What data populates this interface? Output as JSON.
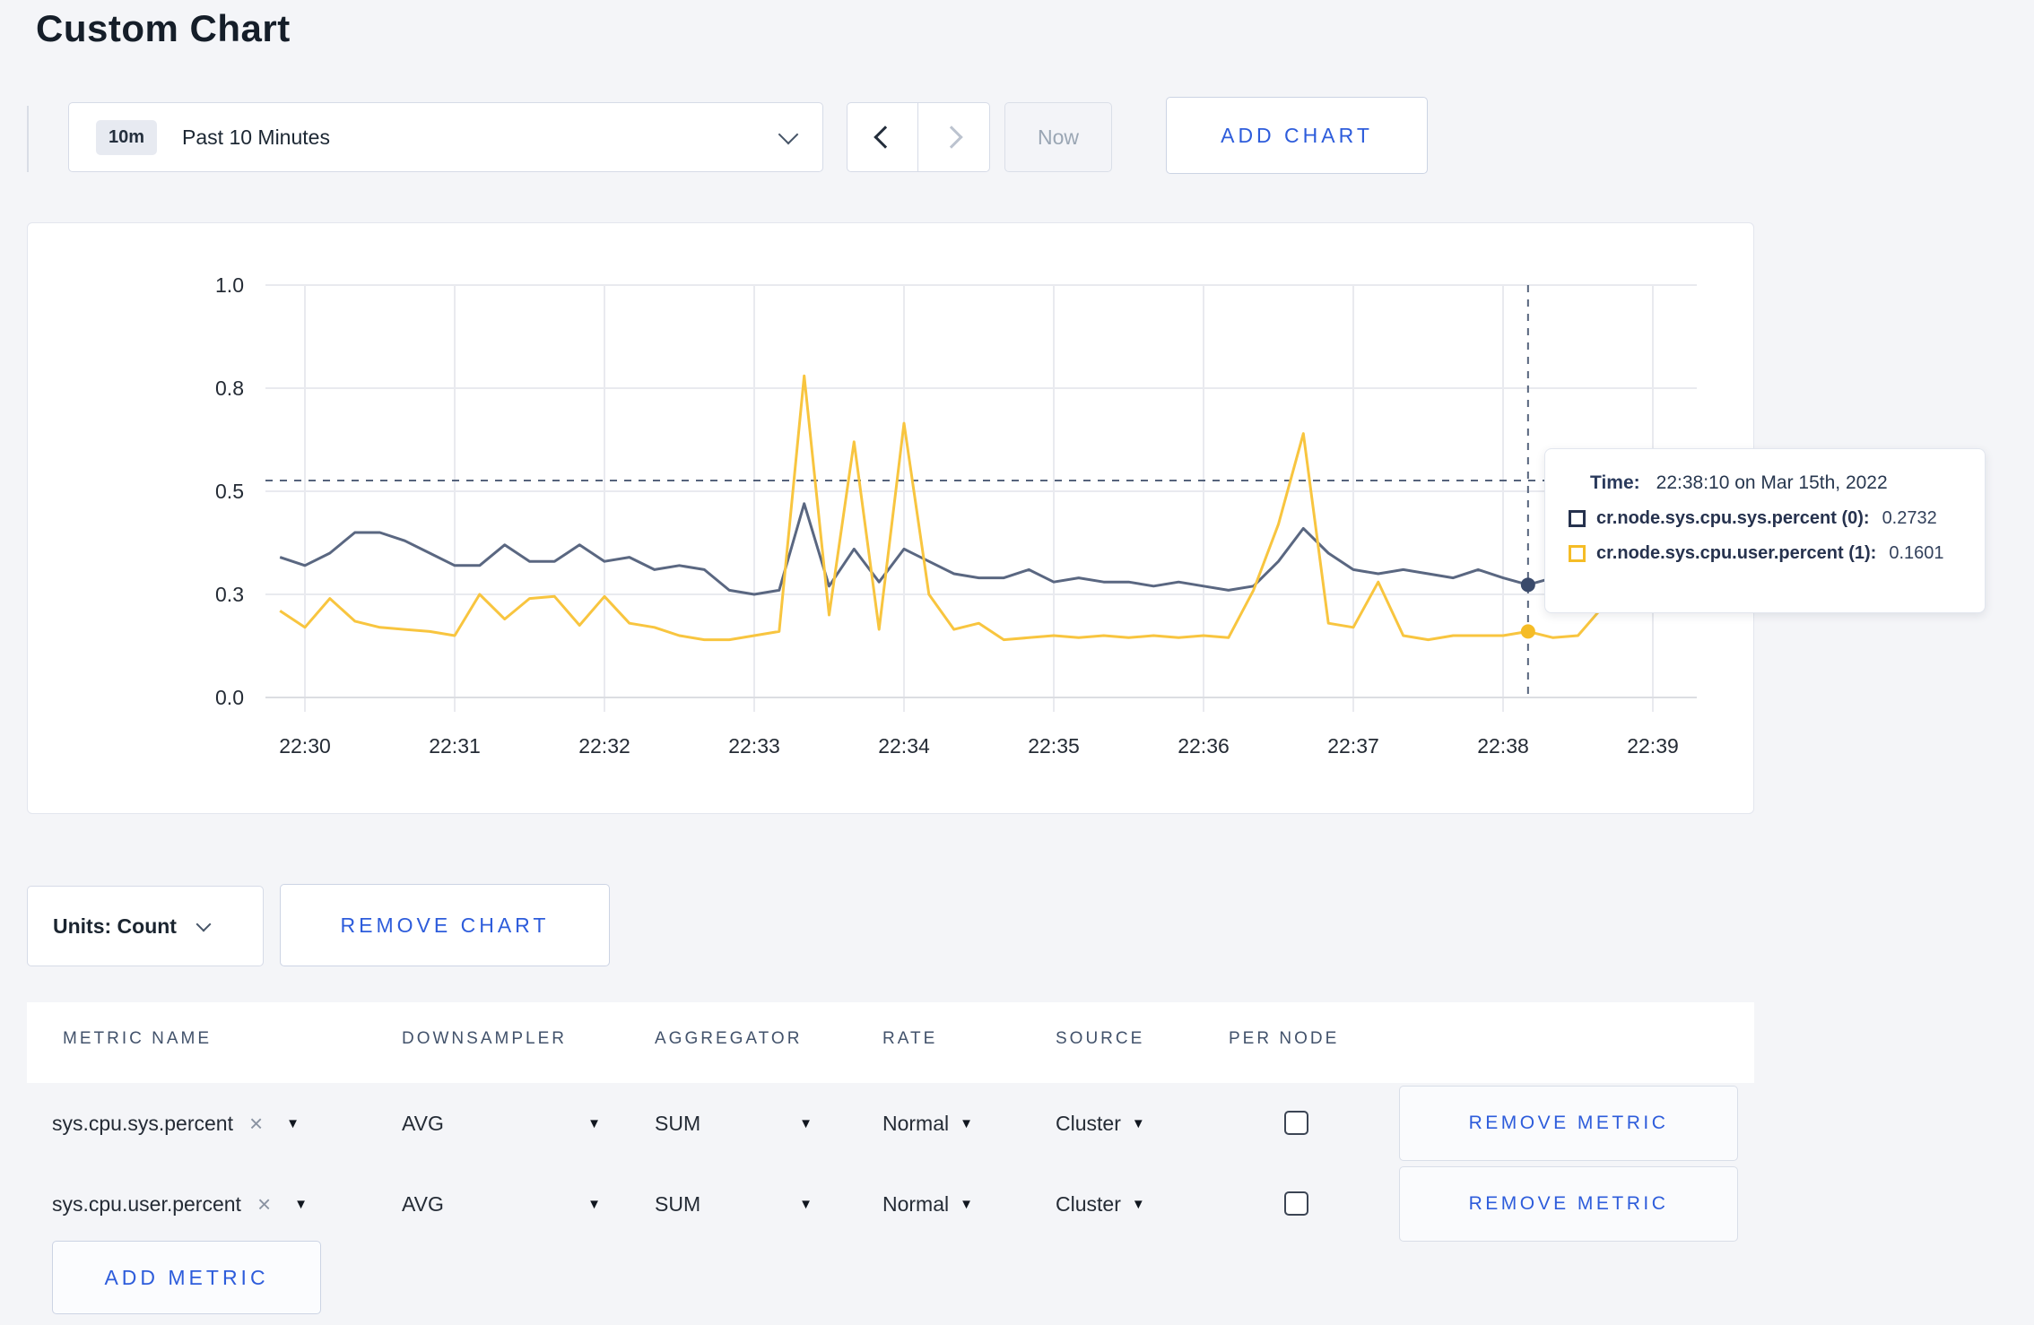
{
  "page": {
    "title": "Custom Chart"
  },
  "toolbar": {
    "time_badge": "10m",
    "time_label": "Past 10 Minutes",
    "prev_label": "previous range",
    "next_label": "next range",
    "now_label": "Now",
    "add_chart_label": "ADD CHART"
  },
  "chart_data": {
    "type": "line",
    "title": "",
    "xlabel": "",
    "ylabel": "",
    "ylim": [
      0,
      1
    ],
    "grid": true,
    "y_ticks": [
      {
        "label": "0.0",
        "value": 0.0
      },
      {
        "label": "0.3",
        "value": 0.25
      },
      {
        "label": "0.5",
        "value": 0.5
      },
      {
        "label": "0.8",
        "value": 0.75
      },
      {
        "label": "1.0",
        "value": 1.0
      }
    ],
    "x_ticks": [
      "22:30",
      "22:31",
      "22:32",
      "22:33",
      "22:34",
      "22:35",
      "22:36",
      "22:37",
      "22:38",
      "22:39"
    ],
    "x": [
      "22:29:50",
      "22:30:00",
      "22:30:10",
      "22:30:20",
      "22:30:30",
      "22:30:40",
      "22:30:50",
      "22:31:00",
      "22:31:10",
      "22:31:20",
      "22:31:30",
      "22:31:40",
      "22:31:50",
      "22:32:00",
      "22:32:10",
      "22:32:20",
      "22:32:30",
      "22:32:40",
      "22:32:50",
      "22:33:00",
      "22:33:10",
      "22:33:20",
      "22:33:30",
      "22:33:40",
      "22:33:50",
      "22:34:00",
      "22:34:10",
      "22:34:20",
      "22:34:30",
      "22:34:40",
      "22:34:50",
      "22:35:00",
      "22:35:10",
      "22:35:20",
      "22:35:30",
      "22:35:40",
      "22:35:50",
      "22:36:00",
      "22:36:10",
      "22:36:20",
      "22:36:30",
      "22:36:40",
      "22:36:50",
      "22:37:00",
      "22:37:10",
      "22:37:20",
      "22:37:30",
      "22:37:40",
      "22:37:50",
      "22:38:00",
      "22:38:10",
      "22:38:20",
      "22:38:30",
      "22:38:40",
      "22:38:50",
      "22:39:00",
      "22:39:10"
    ],
    "series": [
      {
        "name": "cr.node.sys.cpu.sys.percent",
        "color": "#5a6781",
        "values": [
          0.34,
          0.32,
          0.35,
          0.4,
          0.4,
          0.38,
          0.35,
          0.32,
          0.32,
          0.37,
          0.33,
          0.33,
          0.37,
          0.33,
          0.34,
          0.31,
          0.32,
          0.31,
          0.26,
          0.25,
          0.26,
          0.47,
          0.27,
          0.36,
          0.28,
          0.36,
          0.33,
          0.3,
          0.29,
          0.29,
          0.31,
          0.28,
          0.29,
          0.28,
          0.28,
          0.27,
          0.28,
          0.27,
          0.26,
          0.27,
          0.33,
          0.41,
          0.35,
          0.31,
          0.3,
          0.31,
          0.3,
          0.29,
          0.31,
          0.29,
          0.2732,
          0.29,
          0.3,
          0.31,
          0.3,
          0.3,
          0.31
        ]
      },
      {
        "name": "cr.node.sys.cpu.user.percent",
        "color": "#f8c53f",
        "values": [
          0.21,
          0.17,
          0.24,
          0.185,
          0.17,
          0.165,
          0.16,
          0.15,
          0.25,
          0.19,
          0.24,
          0.245,
          0.175,
          0.245,
          0.18,
          0.17,
          0.15,
          0.14,
          0.14,
          0.15,
          0.16,
          0.78,
          0.2,
          0.62,
          0.165,
          0.665,
          0.25,
          0.165,
          0.18,
          0.14,
          0.145,
          0.15,
          0.145,
          0.15,
          0.145,
          0.15,
          0.145,
          0.15,
          0.145,
          0.26,
          0.42,
          0.64,
          0.18,
          0.17,
          0.28,
          0.15,
          0.14,
          0.15,
          0.15,
          0.15,
          0.1601,
          0.145,
          0.15,
          0.22,
          0.28,
          0.22,
          0.24
        ]
      }
    ],
    "crosshair": {
      "time": "22:38:10",
      "guide_value": 0.526
    },
    "legend_position": "tooltip"
  },
  "tooltip": {
    "time_label": "Time:",
    "time_value": "22:38:10 on Mar 15th, 2022",
    "rows": [
      {
        "label": "cr.node.sys.cpu.sys.percent (0):",
        "value": "0.2732",
        "color": "#26324e"
      },
      {
        "label": "cr.node.sys.cpu.user.percent (1):",
        "value": "0.1601",
        "color": "#f5bc26"
      }
    ]
  },
  "chart_footer": {
    "units_label": "Units: Count",
    "remove_chart_label": "REMOVE CHART"
  },
  "metrics_table": {
    "headers": [
      "METRIC NAME",
      "DOWNSAMPLER",
      "AGGREGATOR",
      "RATE",
      "SOURCE",
      "PER NODE"
    ],
    "rows": [
      {
        "metric_name": "sys.cpu.sys.percent",
        "downsampler": "AVG",
        "aggregator": "SUM",
        "rate": "Normal",
        "source": "Cluster",
        "per_node_checked": false,
        "remove_label": "REMOVE METRIC"
      },
      {
        "metric_name": "sys.cpu.user.percent",
        "downsampler": "AVG",
        "aggregator": "SUM",
        "rate": "Normal",
        "source": "Cluster",
        "per_node_checked": false,
        "remove_label": "REMOVE METRIC"
      }
    ],
    "add_metric_label": "ADD METRIC"
  },
  "colors": {
    "accent_blue": "#2d5cdb",
    "navy_series": "#5a6781",
    "yellow_series": "#f8c53f",
    "page_background": "#f4f5f8",
    "grid_line": "#e9eaef",
    "crosshair": "#44546e"
  }
}
